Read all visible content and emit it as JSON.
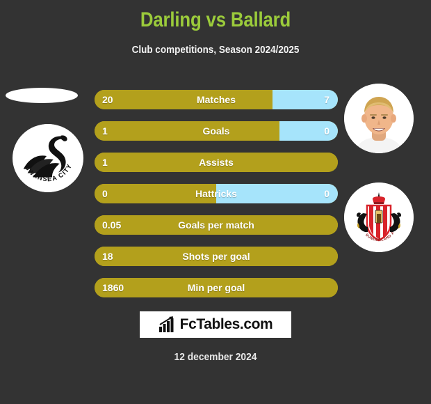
{
  "header": {
    "title": "Darling vs Ballard",
    "subtitle": "Club competitions, Season 2024/2025"
  },
  "teams": {
    "left": {
      "crest_name": "swansea-city-afc-crest",
      "crest_text": "SWANSEA CITY AFC",
      "player_photo": "missing-player-photo-placeholder"
    },
    "right": {
      "crest_name": "sunderland-afc-crest",
      "crest_text": "SUNDERLAND A.F.C.",
      "player_photo": "player-photo-ballard"
    }
  },
  "stats": [
    {
      "label": "Matches",
      "left": "20",
      "right": "7",
      "left_pct": 73,
      "right_pct": 27,
      "split": true
    },
    {
      "label": "Goals",
      "left": "1",
      "right": "0",
      "left_pct": 76,
      "right_pct": 24,
      "split": true
    },
    {
      "label": "Assists",
      "left": "1",
      "right": "",
      "left_pct": 100,
      "right_pct": 0,
      "split": false
    },
    {
      "label": "Hattricks",
      "left": "0",
      "right": "0",
      "left_pct": 50,
      "right_pct": 50,
      "split": true
    },
    {
      "label": "Goals per match",
      "left": "0.05",
      "right": "",
      "left_pct": 100,
      "right_pct": 0,
      "split": false
    },
    {
      "label": "Shots per goal",
      "left": "18",
      "right": "",
      "left_pct": 100,
      "right_pct": 0,
      "split": false
    },
    {
      "label": "Min per goal",
      "left": "1860",
      "right": "",
      "left_pct": 100,
      "right_pct": 0,
      "split": false
    }
  ],
  "footer": {
    "brand": "FcTables.com",
    "brand_icon": "bar-chart-arrow-icon",
    "date": "12 december 2024"
  },
  "colors": {
    "background": "#333333",
    "title": "#9bcb3b",
    "bar_left": "#b3a01c",
    "bar_right": "#a6e4fb",
    "text": "#ffffff"
  }
}
